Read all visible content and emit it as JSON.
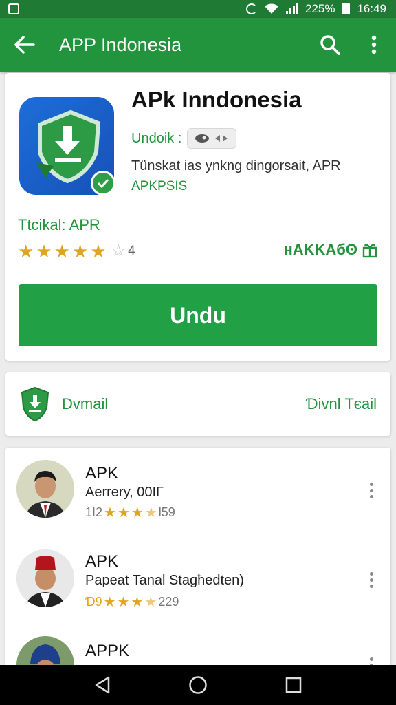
{
  "status_bar": {
    "battery_text": "225%",
    "time": "16:49"
  },
  "app_bar": {
    "title": "APP Indonesia",
    "icons": [
      "back-arrow-icon",
      "search-icon",
      "more-vert-icon"
    ]
  },
  "app": {
    "name": "APk Inndonesia",
    "undoik_label": "Undoik :",
    "description": "Tünskat ias ynkng dingorsait, APR",
    "description_sub": "APKPSIS",
    "tag_line": "Ttcikal: APR",
    "rating_stars": 5,
    "rating_count": "4",
    "brand_label": "ʜAKKAбʘ",
    "install_label": "Undu"
  },
  "detail_card": {
    "left_label": "Dvmaіl",
    "right_link": "Ɗivnl Tєail"
  },
  "list": [
    {
      "title": "APK",
      "subtitle": "Aerrery, 00ΙΓ",
      "rating_prefix": "1І2",
      "stars": 3.5,
      "rating_suffix": "Ɩ59"
    },
    {
      "title": "APK",
      "subtitle": "Papeat Tanal Stagħedten)",
      "rating_prefix": "Ɗ9",
      "stars": 3.5,
      "rating_suffix": "229"
    },
    {
      "title": "APPK",
      "subtitle": "",
      "rating_prefix": "",
      "stars": 0,
      "rating_suffix": ""
    }
  ],
  "colors": {
    "status_bar": "#1f7a34",
    "app_bar": "#23943e",
    "install_button": "#22a045",
    "accent_green": "#23943e",
    "star": "#e0a520"
  }
}
